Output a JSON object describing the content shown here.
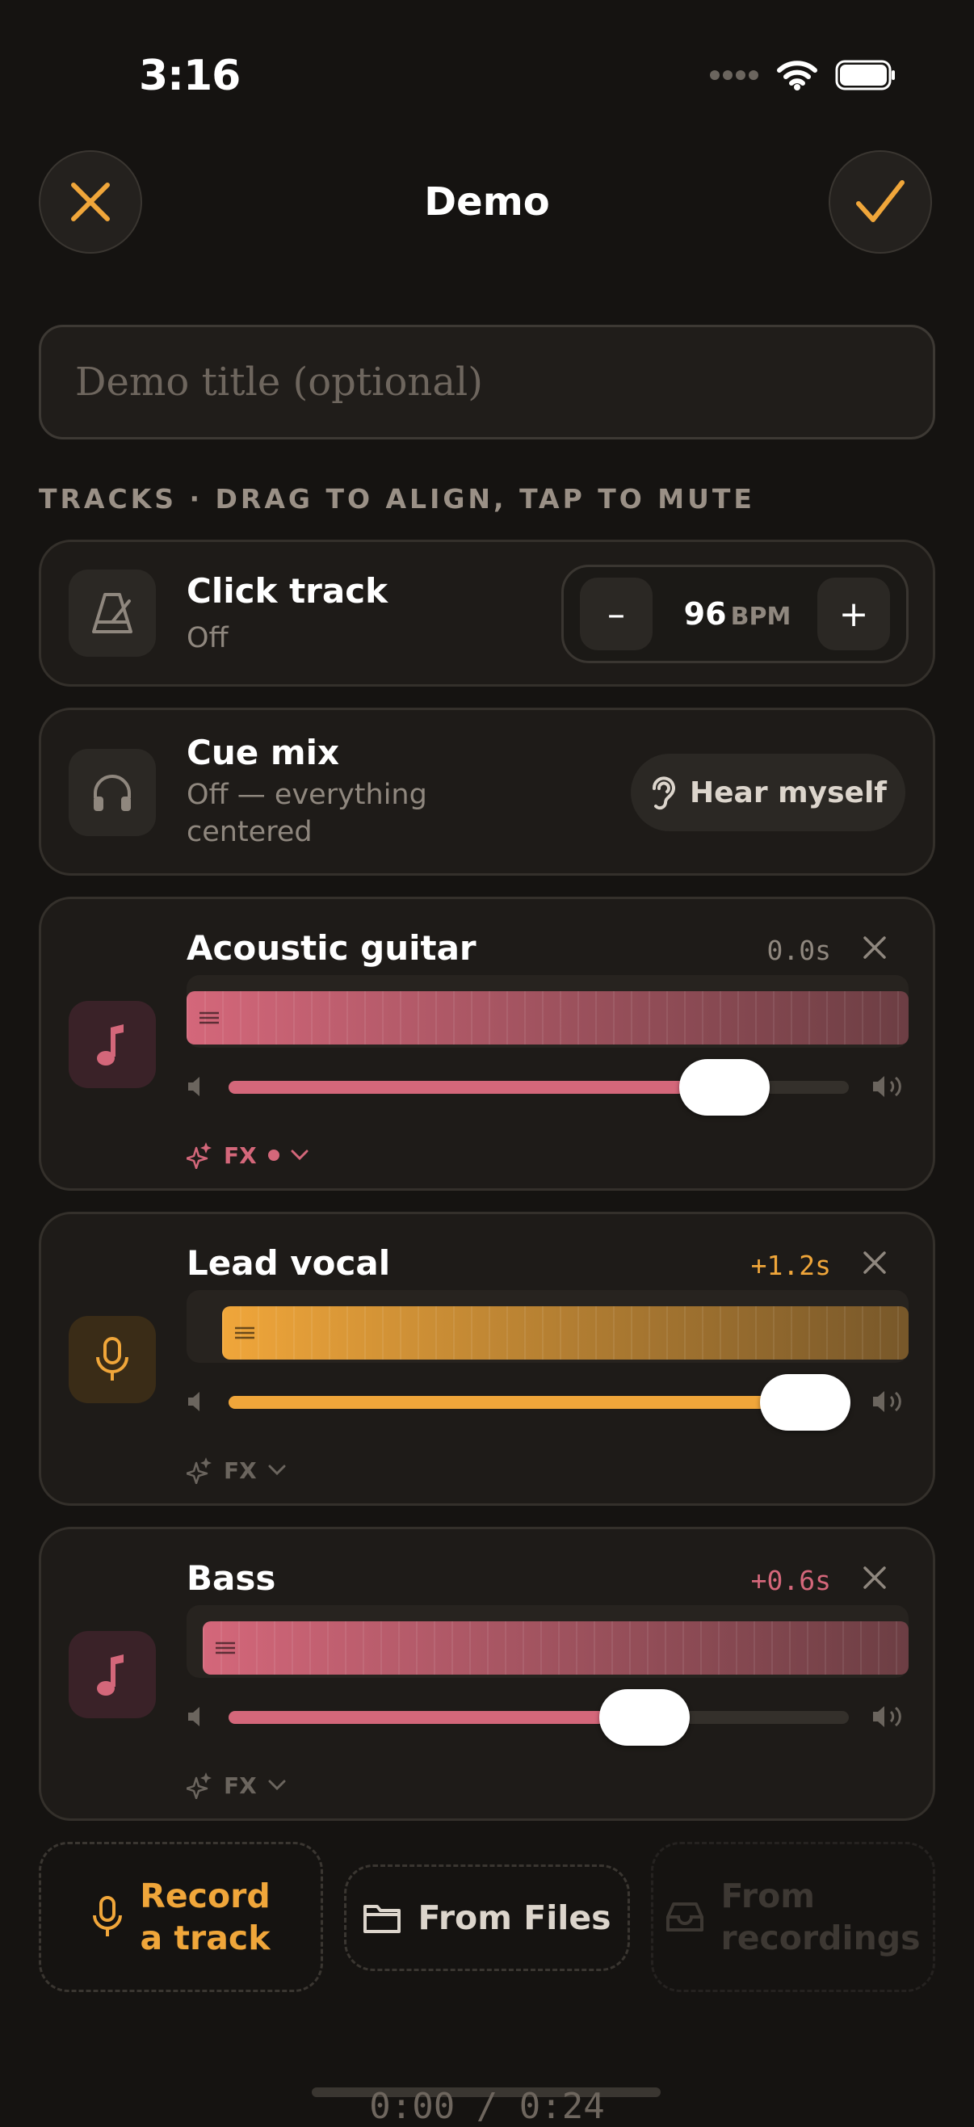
{
  "status": {
    "time": "3:16"
  },
  "header": {
    "title": "Demo"
  },
  "title_field": {
    "placeholder": "Demo title (optional)",
    "value": ""
  },
  "section_label": "TRACKS · DRAG TO ALIGN, TAP TO MUTE",
  "click_track": {
    "name": "Click track",
    "status": "Off",
    "bpm": "96",
    "bpm_unit": "BPM",
    "minus": "–",
    "plus": "+"
  },
  "cue_mix": {
    "name": "Cue mix",
    "status_line1": "Off — everything",
    "status_line2": "centered",
    "hear_label": "Hear myself"
  },
  "tracks": [
    {
      "name": "Acoustic guitar",
      "offset": "0.0s",
      "volume": 0.8,
      "fx_label": "FX",
      "fx_active": true,
      "color": "#d4677a"
    },
    {
      "name": "Lead vocal",
      "offset": "+1.2s",
      "volume": 0.93,
      "fx_label": "FX",
      "fx_active": false,
      "color": "#f0a63a"
    },
    {
      "name": "Bass",
      "offset": "+0.6s",
      "volume": 0.67,
      "fx_label": "FX",
      "fx_active": false,
      "color": "#d4677a"
    }
  ],
  "add": {
    "record_line1": "Record",
    "record_line2": "a track",
    "files_label": "From Files",
    "recordings_line1": "From",
    "recordings_line2": "recordings"
  },
  "playback": {
    "timecode": "0:00 / 0:24"
  },
  "colors": {
    "accent": "#f0a63a",
    "pink": "#d4677a",
    "background": "#151311"
  }
}
